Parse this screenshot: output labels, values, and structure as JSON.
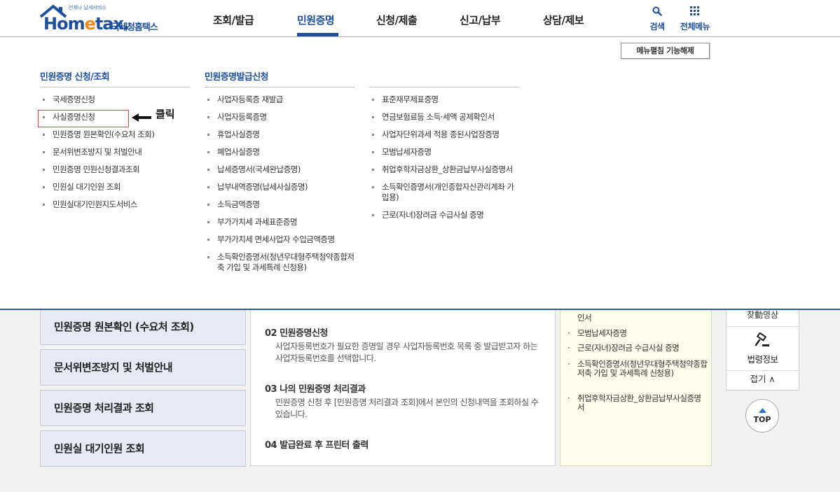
{
  "header": {
    "logo": {
      "sub_text": "언제나 납세서비스",
      "brand_main": "Hom",
      "brand_e": "e",
      "brand_tail": "tax.",
      "brand_kor": "국세청홈택스"
    },
    "nav": [
      "조회/발급",
      "민원증명",
      "신청/제출",
      "신고/납부",
      "상담/제보"
    ],
    "active_nav": "민원증명",
    "tools": {
      "search_label": "검색",
      "all_menu_label": "전체메뉴"
    },
    "accent_color": "#1e4f9c"
  },
  "mega_menu": {
    "toggle_button": "메뉴펼침 기능해제",
    "col1": {
      "title": "민원증명 신청/조회",
      "items": [
        "국세증명신청",
        "사실증명신청",
        "민원증명 원본확인(수요처 조회)",
        "문서위변조방지 및 처벌안내",
        "민원증명 민원신청결과조회",
        "민원실 대기인원 조회",
        "민원실대기인원지도서비스"
      ]
    },
    "col2": {
      "title": "민원증명발급신청",
      "items": [
        "사업자등록증 재발급",
        "사업자등록증명",
        "휴업사실증명",
        "폐업사실증명",
        "납세증명서(국세완납증명)",
        "납부내역증명(납세사실증명)",
        "소득금액증명",
        "부가가치세 과세표준증명",
        "부가가치세 면세사업자 수입금액증명",
        "소득확인증명서(청년우대형주택청약종합저축 가입 및 과세특례 신청용)"
      ]
    },
    "col3": {
      "items": [
        "표준재무제표증명",
        "연금보험료등 소득·세액 공제확인서",
        "사업자단위과세 적용 종된사업장증명",
        "모범납세자증명",
        "취업후학자금상환_상환금납부사실증명서",
        "소득확인증명서(개인종합자산관리계좌 가입용)",
        "근로(자녀)장려금 수급사실 증명"
      ]
    },
    "annotation": {
      "label": "클릭",
      "highlight_color": "#e0443f"
    }
  },
  "background": {
    "side_buttons": [
      "민원증명 원본확인 (수요처 조회)",
      "문서위변조방지 및 처벌안내",
      "민원증명 처리결과 조회",
      "민원실 대기인원 조회"
    ],
    "steps": [
      {
        "title": "02 민원증명신청",
        "desc": "사업자등록번호가 필요한 증명일 경우 사업자등록번호 목록 중 발급받고자 하는 사업자등록번호를 선택합니다."
      },
      {
        "title": "03 나의 민원증명 처리결과",
        "desc": "민원증명 신청 후 [민원증명 처리결과 조회]에서 본인의 신청내역을 조회하실 수 있습니다."
      },
      {
        "title": "04 발급완료 후 프린터 출력",
        "desc": ""
      }
    ],
    "right_list": [
      "인서",
      "모범납세자증명",
      "근로(자녀)장려금 수급사실 증명",
      "소득확인증명서(청년우대형주택청약종합저축 가입 및 과세특례 신청용)",
      "취업후학자금상환_상환금납부사실증명서"
    ],
    "right_bullet": "·",
    "quick": {
      "partial_label": "찾動영상",
      "law_label": "법령정보",
      "fold_label": "접기 ∧"
    },
    "top_label": "TOP"
  }
}
